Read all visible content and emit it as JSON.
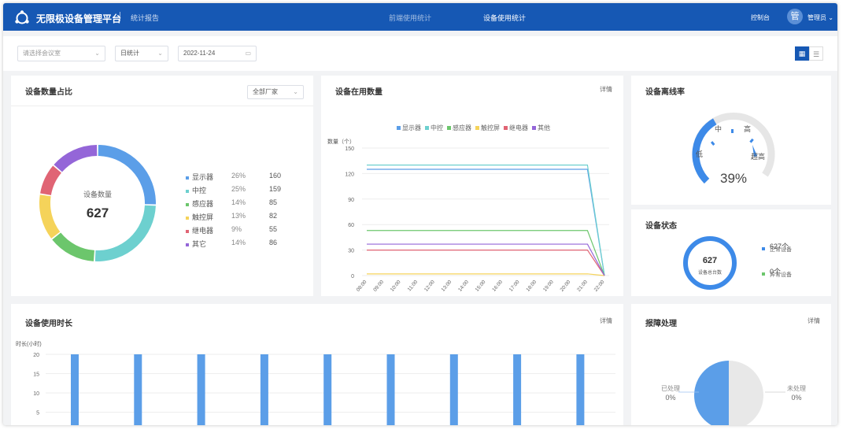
{
  "header": {
    "app_title": "无限极设备管理平台",
    "report_tab": "统计报告",
    "nav_tabs": [
      "前端使用统计",
      "设备使用统计"
    ],
    "console": "控制台",
    "avatar_char": "管",
    "user": "管理员"
  },
  "filters": {
    "location_placeholder": "请选择会议室",
    "period": "日统计",
    "date": "2022-11-24"
  },
  "colors": {
    "brand": "#1658b4",
    "blue": "#5b9ee8",
    "teal": "#6dd0cf",
    "green": "#6cc66c",
    "yellow": "#f5d35a",
    "red": "#e06474",
    "purple": "#9466d8"
  },
  "device_share": {
    "title": "设备数量占比",
    "filter": "全部厂家",
    "center_label": "设备数量",
    "center_value": "627",
    "items": [
      {
        "name": "显示器",
        "pct": "26%",
        "count": "160",
        "color": "#5b9ee8"
      },
      {
        "name": "中控",
        "pct": "25%",
        "count": "159",
        "color": "#6dd0cf"
      },
      {
        "name": "感应器",
        "pct": "14%",
        "count": "85",
        "color": "#6cc66c"
      },
      {
        "name": "触控屏",
        "pct": "13%",
        "count": "82",
        "color": "#f5d35a"
      },
      {
        "name": "继电器",
        "pct": "9%",
        "count": "55",
        "color": "#e06474"
      },
      {
        "name": "其它",
        "pct": "14%",
        "count": "86",
        "color": "#9466d8"
      }
    ]
  },
  "in_use": {
    "title": "设备在用数量",
    "link": "详情",
    "ylabel": "数量（个）",
    "legend": [
      "显示器",
      "中控",
      "感应器",
      "触控屏",
      "继电器",
      "其他"
    ]
  },
  "chart_data": [
    {
      "type": "line",
      "title": "设备在用数量",
      "ylabel": "数量（个）",
      "ylim": [
        0,
        150
      ],
      "yticks": [
        "0",
        "30",
        "60",
        "90",
        "120",
        "150"
      ],
      "x": [
        "08:00",
        "09:00",
        "10:00",
        "11:00",
        "12:00",
        "13:00",
        "14:00",
        "15:00",
        "16:00",
        "17:00",
        "18:00",
        "19:00",
        "20:00",
        "21:00",
        "22:00"
      ],
      "series": [
        {
          "name": "显示器",
          "color": "#5b9ee8",
          "values": [
            125,
            125,
            125,
            125,
            125,
            125,
            125,
            125,
            125,
            125,
            125,
            125,
            125,
            125,
            0
          ]
        },
        {
          "name": "中控",
          "color": "#6dd0cf",
          "values": [
            130,
            130,
            130,
            130,
            130,
            130,
            130,
            130,
            130,
            130,
            130,
            130,
            130,
            130,
            0
          ]
        },
        {
          "name": "感应器",
          "color": "#6cc66c",
          "values": [
            53,
            53,
            53,
            53,
            53,
            53,
            53,
            53,
            53,
            53,
            53,
            53,
            53,
            53,
            0
          ]
        },
        {
          "name": "触控屏",
          "color": "#f5d35a",
          "values": [
            2,
            2,
            2,
            2,
            2,
            2,
            2,
            2,
            2,
            2,
            2,
            2,
            2,
            2,
            0
          ]
        },
        {
          "name": "继电器",
          "color": "#e06474",
          "values": [
            30,
            30,
            30,
            30,
            30,
            30,
            30,
            30,
            30,
            30,
            30,
            30,
            30,
            30,
            0
          ]
        },
        {
          "name": "其他",
          "color": "#9466d8",
          "values": [
            37,
            37,
            37,
            37,
            37,
            37,
            37,
            37,
            37,
            37,
            37,
            37,
            37,
            37,
            0
          ]
        }
      ]
    },
    {
      "type": "bar",
      "title": "设备使用时长",
      "ylabel": "时长(小时)",
      "ylim": [
        0,
        20
      ],
      "yticks": [
        "5",
        "10",
        "15",
        "20"
      ],
      "values": [
        20,
        20,
        20,
        20,
        20,
        20,
        20,
        20,
        20
      ]
    },
    {
      "type": "pie",
      "title": "报障处理",
      "series": [
        {
          "name": "已处理",
          "label": "0%",
          "value": 50
        },
        {
          "name": "未处理",
          "label": "0%",
          "value": 50
        }
      ]
    }
  ],
  "offline": {
    "title": "设备离线率",
    "value": 0.39,
    "value_label": "39%",
    "labels": {
      "low": "低",
      "mid": "中",
      "high": "高",
      "very_high": "超高"
    }
  },
  "status": {
    "title": "设备状态",
    "total": "627",
    "total_label": "设备总台数",
    "rows": [
      {
        "count": "627个",
        "label": "正常设备"
      },
      {
        "count": "0个",
        "label": "异常设备"
      }
    ]
  },
  "usage": {
    "title": "设备使用时长",
    "link": "详情",
    "ylabel": "时长(小时)"
  },
  "faults": {
    "title": "报障处理",
    "link": "详情",
    "done": "已处理",
    "done_pct": "0%",
    "todo": "未处理",
    "todo_pct": "0%"
  }
}
